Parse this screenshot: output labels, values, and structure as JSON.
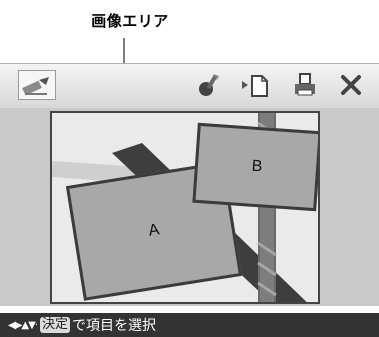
{
  "caption": "画像エリア",
  "toolbar": {
    "icons": {
      "edit": "pen-edit-icon",
      "tool": "brush-tool-icon",
      "save": "arrow-to-document-icon",
      "print": "print-icon",
      "close": "close-icon"
    }
  },
  "preview": {
    "area_a_label": "A",
    "area_b_label": "B"
  },
  "statusbar": {
    "nav_arrows": "◀▶▲▼·",
    "key_label": "決定",
    "instruction": "で項目を選択"
  }
}
